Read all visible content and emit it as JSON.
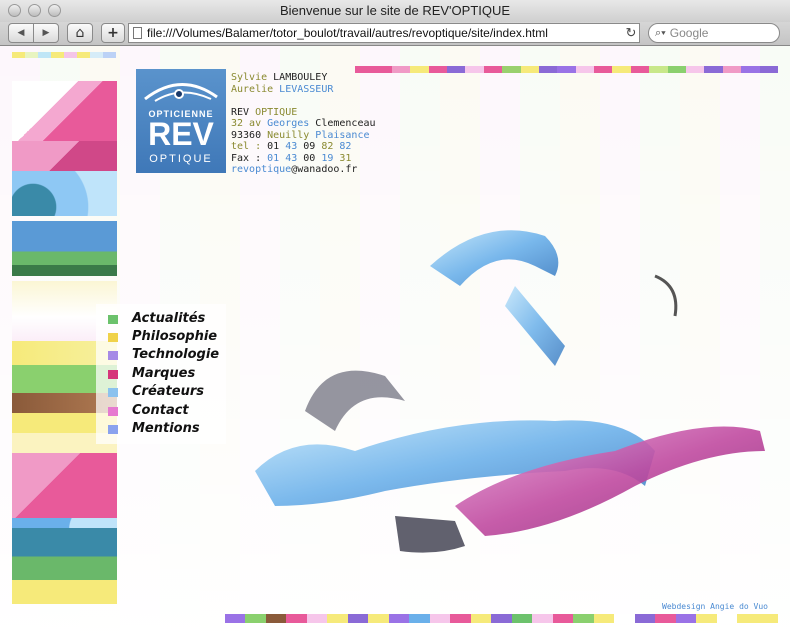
{
  "window": {
    "title": "Bienvenue sur le site de REV'OPTIQUE"
  },
  "toolbar": {
    "back_label": "◀",
    "forward_label": "▶",
    "home_label": "⌂",
    "add_label": "+",
    "url": "file:///Volumes/Balamer/totor_boulot/travail/autres/revoptique/site/index.html",
    "reload_label": "↻",
    "search_placeholder": "Google"
  },
  "logo": {
    "top": "OPTICIENNE",
    "main": "REV",
    "bottom": "OPTIQUE"
  },
  "contact": {
    "line1_a": "Sylvie ",
    "line1_b": "LAMBOULEY",
    "line2_a": "Aurelie ",
    "line2_b": "LEVASSEUR",
    "company_a": "REV ",
    "company_b": "OPTIQUE",
    "addr1_a": "32 av ",
    "addr1_b": "Georges ",
    "addr1_c": "Clemenceau",
    "addr2_a": "93360 ",
    "addr2_b": "Neuilly ",
    "addr2_c": "Plaisance",
    "tel_a": "tel : ",
    "tel_b": "01 ",
    "tel_c": "43 ",
    "tel_d": "09 ",
    "tel_e": "82 ",
    "tel_f": "82",
    "fax_a": "Fax : ",
    "fax_b": "01 ",
    "fax_c": "43 ",
    "fax_d": "00 ",
    "fax_e": "19 ",
    "fax_f": "31",
    "email_a": "revoptique",
    "email_b": "@wanadoo.fr"
  },
  "menu": {
    "items": [
      {
        "label": "Actualités",
        "color": "#6cc26c"
      },
      {
        "label": "Philosophie",
        "color": "#f0d24a"
      },
      {
        "label": "Technologie",
        "color": "#a68ae6"
      },
      {
        "label": "Marques",
        "color": "#d6367a"
      },
      {
        "label": "Créateurs",
        "color": "#8cc2ee"
      },
      {
        "label": "Contact",
        "color": "#e67ad0"
      },
      {
        "label": "Mentions",
        "color": "#8aa2ee"
      }
    ]
  },
  "footer": {
    "credit": "Webdesign Angie do Vuo"
  },
  "palette": {
    "pink": "#e85a9a",
    "green": "#8ad06e",
    "yellow": "#f6ea7a",
    "blue": "#6ab0ea",
    "purple": "#9a72e6",
    "teal": "#3a8aa8",
    "lightblue": "#8ec8f4"
  }
}
